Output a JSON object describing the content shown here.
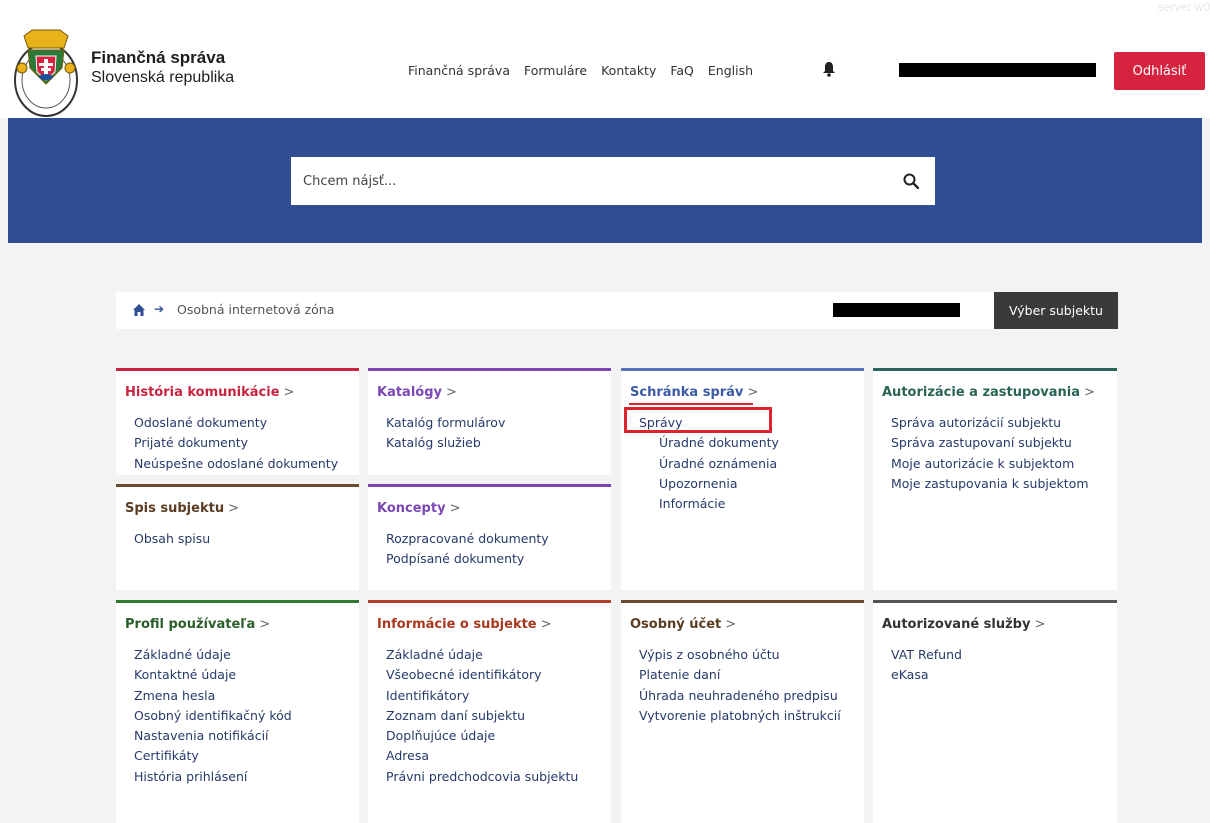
{
  "header": {
    "brand_title": "Finančná správa",
    "brand_subtitle": "Slovenská republika",
    "server_tag": "server w0",
    "nav": [
      "Finančná správa",
      "Formuláre",
      "Kontakty",
      "FaQ",
      "English"
    ],
    "logout_label": "Odhlásiť"
  },
  "search": {
    "placeholder": "Chcem nájsť..."
  },
  "breadcrumb": {
    "current": "Osobná internetová zóna"
  },
  "subject_button_label": "Výber subjektu",
  "colors": {
    "hero": "#2f4e94",
    "logout": "#d6233f",
    "highlight": "#e0222c"
  },
  "cards": {
    "historia": {
      "title": "História komunikácie",
      "color": "#c8243f",
      "items": [
        "Odoslané dokumenty",
        "Prijaté dokumenty",
        "Neúspešne odoslané dokumenty"
      ]
    },
    "katalogy": {
      "title": "Katalógy",
      "color": "#7b47b3",
      "items": [
        "Katalóg formulárov",
        "Katalóg služieb"
      ]
    },
    "schranka": {
      "title": "Schránka správ",
      "color": "#5873bb",
      "items": [
        "Správy",
        "Úradné dokumenty",
        "Úradné oznámenia",
        "Upozornenia",
        "Informácie"
      ]
    },
    "autorizacie": {
      "title": "Autorizácie a zastupovania",
      "color": "#2a6358",
      "items": [
        "Správa autorizácií subjektu",
        "Správa zastupovaní subjektu",
        "Moje autorizácie k subjektom",
        "Moje zastupovania k subjektom"
      ]
    },
    "spis": {
      "title": "Spis subjektu",
      "color": "#6b4a2d",
      "items": [
        "Obsah spisu"
      ]
    },
    "koncepty": {
      "title": "Koncepty",
      "color": "#7b47b3",
      "items": [
        "Rozpracované dokumenty",
        "Podpísané dokumenty"
      ]
    },
    "profil": {
      "title": "Profil používateľa",
      "color": "#2e7a2e",
      "items": [
        "Základné údaje",
        "Kontaktné údaje",
        "Zmena hesla",
        "Osobný identifikačný kód",
        "Nastavenia notifikácií",
        "Certifikáty",
        "História prihlásení"
      ]
    },
    "informacie": {
      "title": "Informácie o subjekte",
      "color": "#b2402c",
      "items": [
        "Základné údaje",
        "Všeobecné identifikátory",
        "Identifikátory",
        "Zoznam daní subjektu",
        "Doplňujúce údaje",
        "Adresa",
        "Právni predchodcovia subjektu"
      ]
    },
    "ucet": {
      "title": "Osobný účet",
      "color": "#6b4a2d",
      "items": [
        "Výpis z osobného účtu",
        "Platenie daní",
        "Úhrada neuhradeného predpisu",
        "Vytvorenie platobných inštrukcií"
      ]
    },
    "sluzby": {
      "title": "Autorizované služby",
      "color": "#555555",
      "items": [
        "VAT Refund",
        "eKasa"
      ]
    }
  }
}
